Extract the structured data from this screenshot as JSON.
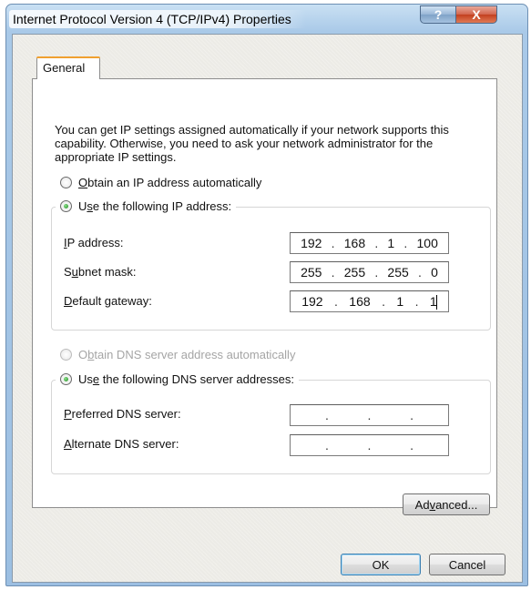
{
  "window": {
    "title": "Internet Protocol Version 4 (TCP/IPv4) Properties",
    "help_glyph": "?",
    "close_glyph": "X"
  },
  "tabs": [
    {
      "label": "General",
      "active": true
    }
  ],
  "intro_text": "You can get IP settings assigned automatically if your network supports this capability. Otherwise, you need to ask your network administrator for the appropriate IP settings.",
  "ip": {
    "auto_option": {
      "mnemonic": "O",
      "rest": "btain an IP address automatically",
      "selected": false
    },
    "manual_option": {
      "pre": "U",
      "mnemonic": "s",
      "rest": "e the following IP address:",
      "selected": true
    },
    "fields": [
      {
        "pre": "",
        "mnemonic": "I",
        "rest": "P address:",
        "octets": [
          "192",
          "168",
          "1",
          "100"
        ]
      },
      {
        "pre": "S",
        "mnemonic": "u",
        "rest": "bnet mask:",
        "octets": [
          "255",
          "255",
          "255",
          "0"
        ]
      },
      {
        "pre": "",
        "mnemonic": "D",
        "rest": "efault gateway:",
        "octets": [
          "192",
          "168",
          "1",
          "1"
        ]
      }
    ]
  },
  "dns": {
    "auto_option": {
      "pre": "O",
      "mnemonic": "b",
      "rest": "tain DNS server address automatically",
      "selected": false,
      "disabled": true
    },
    "manual_option": {
      "pre": "Us",
      "mnemonic": "e",
      "rest": " the following DNS server addresses:",
      "selected": true
    },
    "fields": [
      {
        "pre": "",
        "mnemonic": "P",
        "rest": "referred DNS server:",
        "octets": [
          "",
          "",
          "",
          ""
        ]
      },
      {
        "pre": "",
        "mnemonic": "A",
        "rest": "lternate DNS server:",
        "octets": [
          "",
          "",
          "",
          ""
        ]
      }
    ]
  },
  "buttons": {
    "advanced": {
      "pre": "Ad",
      "mnemonic": "v",
      "rest": "anced..."
    },
    "ok": "OK",
    "cancel": "Cancel"
  },
  "colors": {
    "selected_radio": "#1f8a1f",
    "tab_accent": "#f0a030",
    "close_button": "#c3401f"
  }
}
